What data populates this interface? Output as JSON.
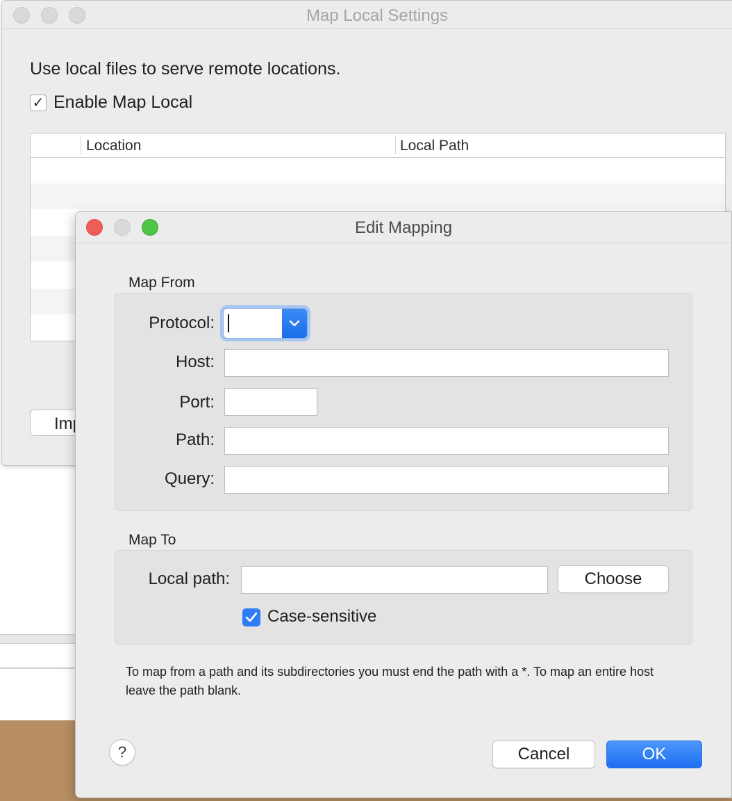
{
  "back_window": {
    "title": "Map Local Settings",
    "description": "Use local files to serve remote locations.",
    "enable_label": "Enable Map Local",
    "enable_checked": true,
    "columns": [
      "Location",
      "Local Path"
    ],
    "import_button_partial": "Imp"
  },
  "dialog": {
    "title": "Edit Mapping",
    "map_from": {
      "title": "Map From",
      "protocol_label": "Protocol:",
      "protocol_value": "",
      "host_label": "Host:",
      "host_value": "",
      "port_label": "Port:",
      "port_value": "",
      "path_label": "Path:",
      "path_value": "",
      "query_label": "Query:",
      "query_value": ""
    },
    "map_to": {
      "title": "Map To",
      "local_path_label": "Local path:",
      "local_path_value": "",
      "choose_button": "Choose",
      "case_sensitive_label": "Case-sensitive",
      "case_sensitive_checked": true
    },
    "help_text": "To map from a path and its subdirectories you must end the path with a *. To map an entire host leave the path blank.",
    "help_button": "?",
    "cancel_button": "Cancel",
    "ok_button": "OK"
  },
  "colors": {
    "accent": "#1d6ff0",
    "close_light": "#ee5e57",
    "zoom_light": "#4ec544",
    "window_bg": "#ececec"
  }
}
